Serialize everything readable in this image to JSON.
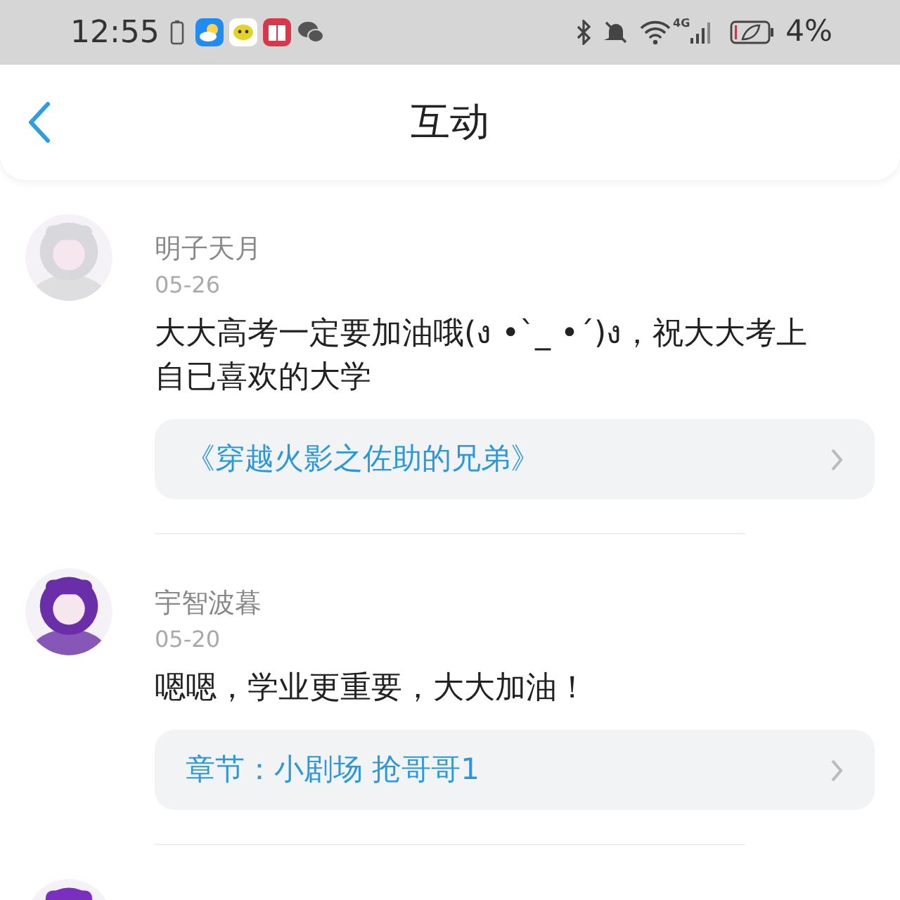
{
  "status_bar": {
    "time": "12:55",
    "network": "4G",
    "battery": "4%"
  },
  "header": {
    "title": "互动"
  },
  "comments": [
    {
      "name": "明子天月",
      "date": "05-26",
      "text": "大大高考一定要加油哦(ง •`_ •´)ง，祝大大考上自已喜欢的大学",
      "link": "《穿越火影之佐助的兄弟》"
    },
    {
      "name": "宇智波暮",
      "date": "05-20",
      "text": "嗯嗯，学业更重要，大大加油！",
      "link": "章节：小剧场 抢哥哥1"
    }
  ]
}
